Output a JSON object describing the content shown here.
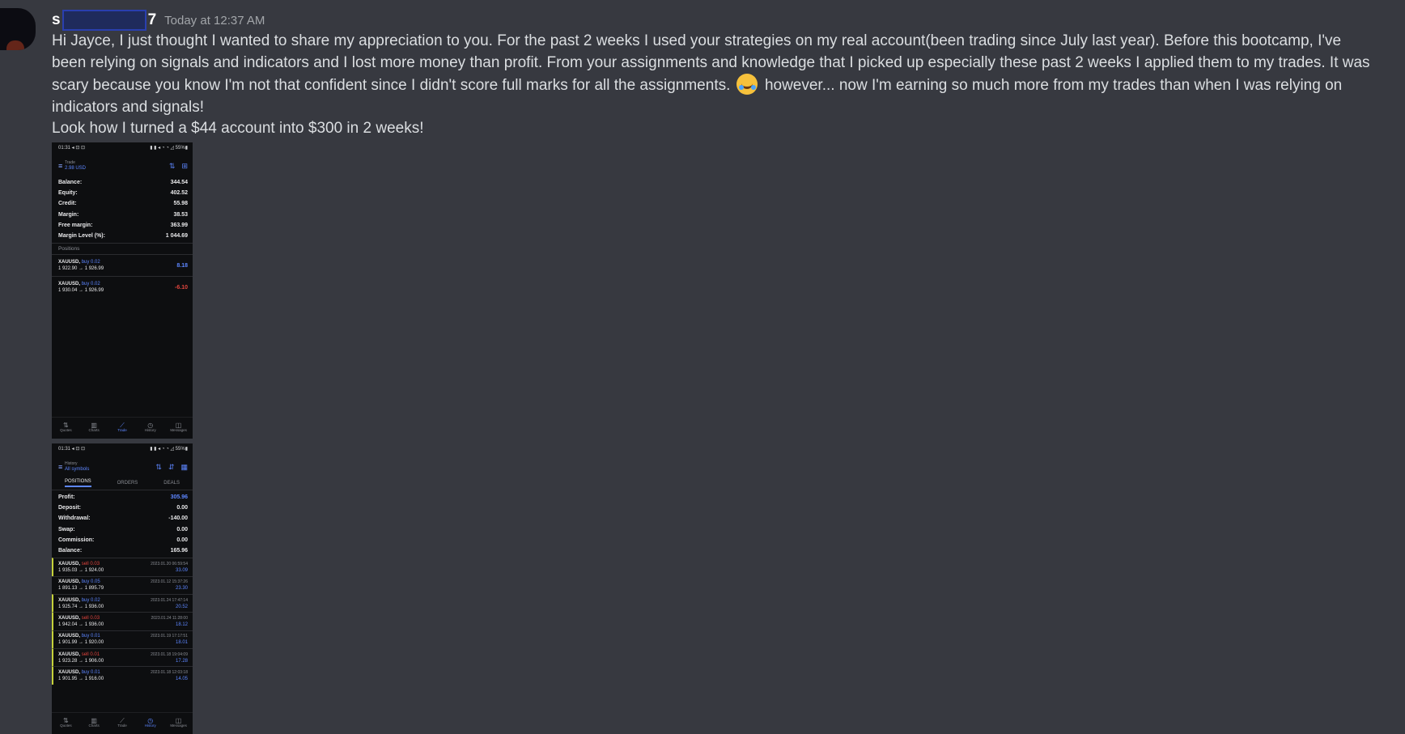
{
  "message": {
    "username_start": "s",
    "username_end": "7",
    "timestamp": "Today at 12:37 AM",
    "paragraph1_before_emoji": "Hi Jayce, I just thought I wanted to share my appreciation to you. For the past 2 weeks I used your strategies on my real account(been trading since July last year). Before this bootcamp, I've been relying on signals and indicators and I lost more money than profit. From your assignments and knowledge that I picked up especially these past 2 weeks I applied them to my trades. It was scary because you know I'm not that confident since I didn't score full marks for all the assignments.",
    "emoji_name": "rolling-on-the-floor-laughing",
    "paragraph1_after_emoji": "however... now I'm earning so much more from my trades than when I was relying on indicators and signals!",
    "paragraph2": "Look how I turned a $44 account into $300 in 2 weeks!"
  },
  "shot1": {
    "status_left": "01:31 ◂ ⊡ ⊡",
    "status_right": "▮ ▮ ◂ ◔ ◔ ◿ 55%▮",
    "title_small": "Trade",
    "title_main": "2.98 USD",
    "summary": [
      {
        "label": "Balance:",
        "value": "344.54"
      },
      {
        "label": "Equity:",
        "value": "402.52"
      },
      {
        "label": "Credit:",
        "value": "55.98"
      },
      {
        "label": "Margin:",
        "value": "38.53"
      },
      {
        "label": "Free margin:",
        "value": "363.99"
      },
      {
        "label": "Margin Level (%):",
        "value": "1 044.69"
      }
    ],
    "positions_header": "Positions",
    "positions": [
      {
        "symbol": "XAUUSD,",
        "side": "buy 0.02",
        "prices": "1 922.90 → 1 926.99",
        "profit": "8.18"
      },
      {
        "symbol": "XAUUSD,",
        "side": "buy 0.02",
        "prices": "1 930.04 → 1 926.99",
        "profit": "-6.10"
      }
    ],
    "nav": [
      "Quotes",
      "Charts",
      "Trade",
      "History",
      "Messages"
    ]
  },
  "shot2": {
    "status_left": "01:31 ◂ ⊡ ⊡",
    "status_right": "▮ ▮ ◂ ◔ ◔ ◿ 55%▮",
    "title_small": "History",
    "title_main": "All symbols",
    "tabs": [
      "POSITIONS",
      "ORDERS",
      "DEALS"
    ],
    "summary": [
      {
        "label": "Profit:",
        "value": "305.96"
      },
      {
        "label": "Deposit:",
        "value": "0.00"
      },
      {
        "label": "Withdrawal:",
        "value": "-140.00"
      },
      {
        "label": "Swap:",
        "value": "0.00"
      },
      {
        "label": "Commission:",
        "value": "0.00"
      },
      {
        "label": "Balance:",
        "value": "165.96"
      }
    ],
    "deals": [
      {
        "symbol": "XAUUSD,",
        "side": "sell 0.03",
        "prices": "1 935.03 → 1 924.00",
        "time": "2023.01.20 06:59:54",
        "profit": "33.09"
      },
      {
        "symbol": "XAUUSD,",
        "side": "buy 0.05",
        "prices": "1 891.13 → 1 895.79",
        "time": "2023.01.12 15:37:26",
        "profit": "23.30"
      },
      {
        "symbol": "XAUUSD,",
        "side": "buy 0.02",
        "prices": "1 925.74 → 1 936.00",
        "time": "2023.01.24 17:47:14",
        "profit": "20.52"
      },
      {
        "symbol": "XAUUSD,",
        "side": "sell 0.03",
        "prices": "1 942.04 → 1 936.00",
        "time": "2023.01.24 11:28:00",
        "profit": "18.12"
      },
      {
        "symbol": "XAUUSD,",
        "side": "buy 0.01",
        "prices": "1 901.99 → 1 920.00",
        "time": "2023.01.19 17:17:51",
        "profit": "18.01"
      },
      {
        "symbol": "XAUUSD,",
        "side": "sell 0.01",
        "prices": "1 923.28 → 1 906.00",
        "time": "2023.01.18 19:04:09",
        "profit": "17.28"
      },
      {
        "symbol": "XAUUSD,",
        "side": "buy 0.01",
        "prices": "1 901.95 → 1 916.00",
        "time": "2023.01.18 12:03:18",
        "profit": "14.05"
      }
    ],
    "nav": [
      "Quotes",
      "Charts",
      "Trade",
      "History",
      "Messages"
    ]
  }
}
